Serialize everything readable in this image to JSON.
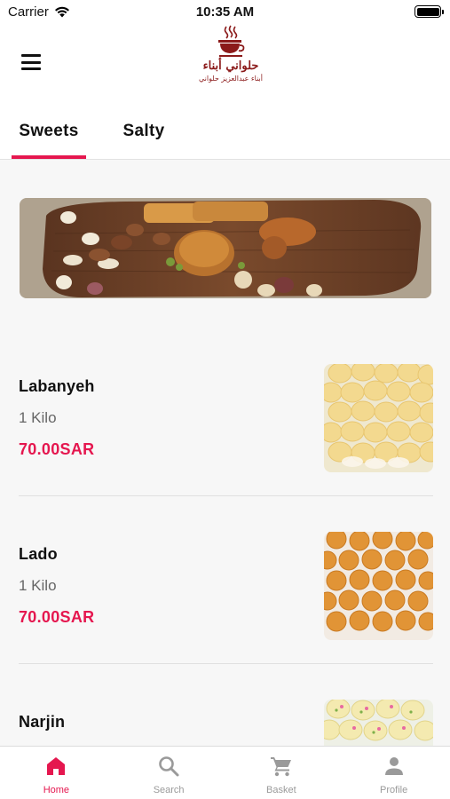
{
  "status_bar": {
    "carrier": "Carrier",
    "time": "10:35 AM"
  },
  "header": {
    "logo_text_line1": "حلواني أبناء",
    "logo_text_line2": "أبناء عبدالعزيز حلواني"
  },
  "tabs": [
    {
      "label": "Sweets",
      "active": true
    },
    {
      "label": "Salty",
      "active": false
    }
  ],
  "products": [
    {
      "name": "Labanyeh",
      "quantity": "1 Kilo",
      "price": "70.00SAR",
      "image": "labanyeh-photo"
    },
    {
      "name": "Lado",
      "quantity": "1 Kilo",
      "price": "70.00SAR",
      "image": "lado-photo"
    },
    {
      "name": "Narjin",
      "quantity": "",
      "price": "",
      "image": "narjin-photo"
    }
  ],
  "bottom_nav": [
    {
      "label": "Home",
      "icon": "home-icon",
      "active": true
    },
    {
      "label": "Search",
      "icon": "search-icon",
      "active": false
    },
    {
      "label": "Basket",
      "icon": "cart-icon",
      "active": false
    },
    {
      "label": "Profile",
      "icon": "person-icon",
      "active": false
    }
  ],
  "colors": {
    "accent": "#e5174f",
    "logo": "#8b1a1a",
    "inactive": "#9a9a9a"
  }
}
